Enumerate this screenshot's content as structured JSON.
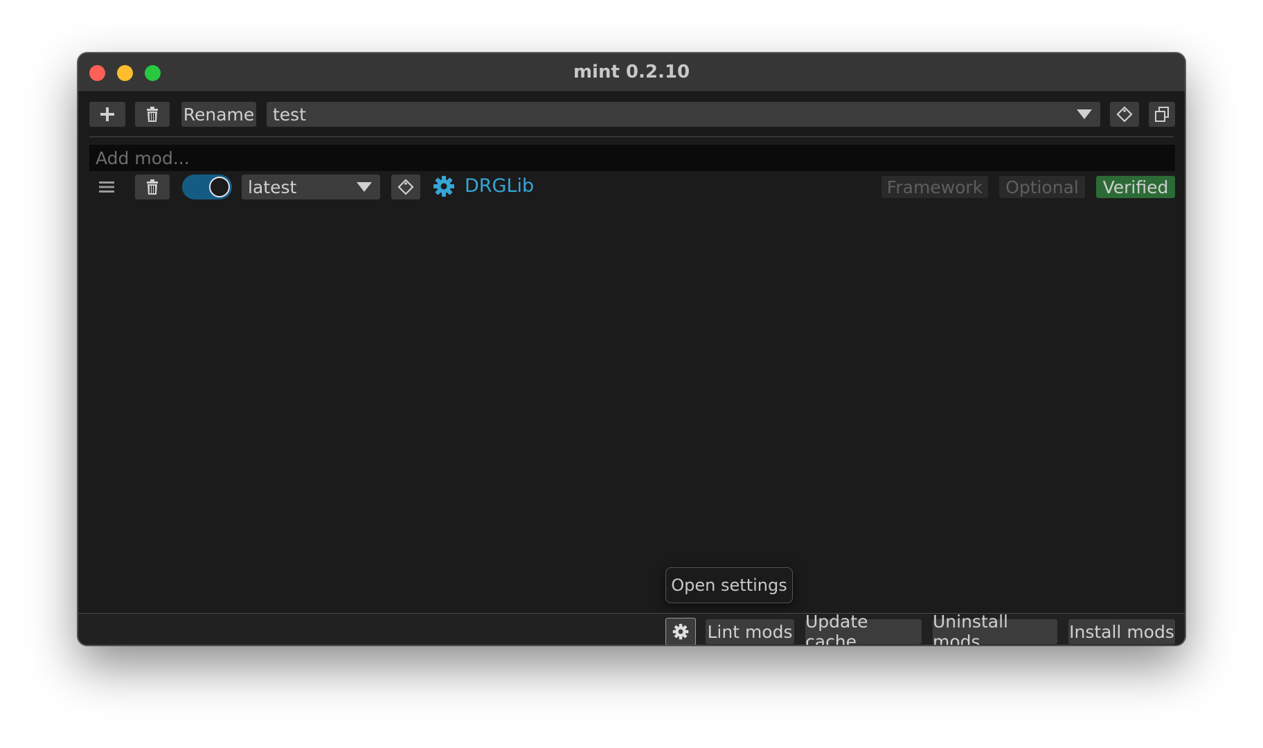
{
  "window": {
    "title": "mint 0.2.10"
  },
  "toolbar": {
    "add_icon": "plus-icon",
    "delete_icon": "trash-icon",
    "rename_label": "Rename",
    "profile_selected": "test",
    "tag_icon": "tag-icon",
    "copy_icon": "copy-icon"
  },
  "add_mod": {
    "placeholder": "Add mod..."
  },
  "mods": [
    {
      "enabled": true,
      "version": "latest",
      "name": "DRGLib",
      "tags": [
        "Framework",
        "Optional",
        "Verified"
      ]
    }
  ],
  "tooltip": {
    "text": "Open settings"
  },
  "bottom_bar": {
    "settings_icon": "gear-icon",
    "lint_label": "Lint mods",
    "update_label": "Update cache",
    "uninstall_label": "Uninstall mods",
    "install_label": "Install mods"
  },
  "colors": {
    "accent_link": "#35a6d6",
    "toggle_on": "#155c85",
    "verified_bg": "#2d6b36"
  }
}
